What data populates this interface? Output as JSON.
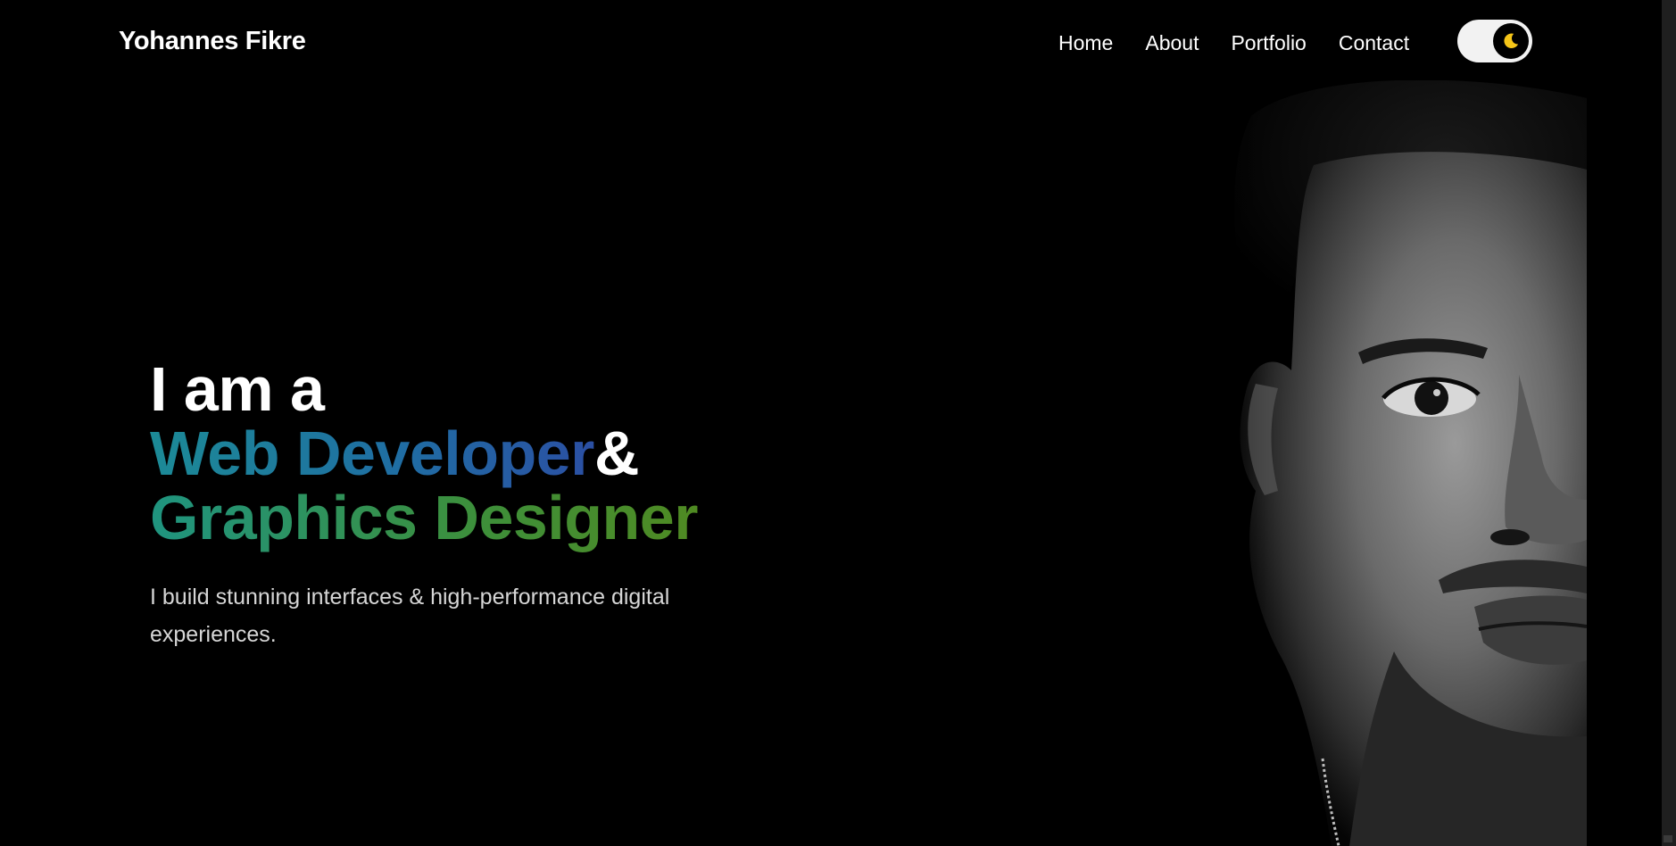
{
  "header": {
    "logo": "Yohannes Fikre",
    "nav": [
      "Home",
      "About",
      "Portfolio",
      "Contact"
    ],
    "theme_toggle": {
      "mode": "dark",
      "icon": "moon-icon",
      "icon_color": "#f5c518"
    }
  },
  "hero": {
    "intro": "I am a",
    "role_1": "Web Developer",
    "ampersand": "&",
    "role_2": "Graphics Designer",
    "subtitle": "I build stunning interfaces & high-performance digital experiences."
  },
  "portrait": {
    "icon": "portrait-photo"
  },
  "colors": {
    "background": "#000000",
    "role_1_gradient": [
      "#1c8a96",
      "#2b4fa3"
    ],
    "role_2_gradient": [
      "#1f9480",
      "#4f8a22"
    ],
    "moon": "#f5c518"
  }
}
